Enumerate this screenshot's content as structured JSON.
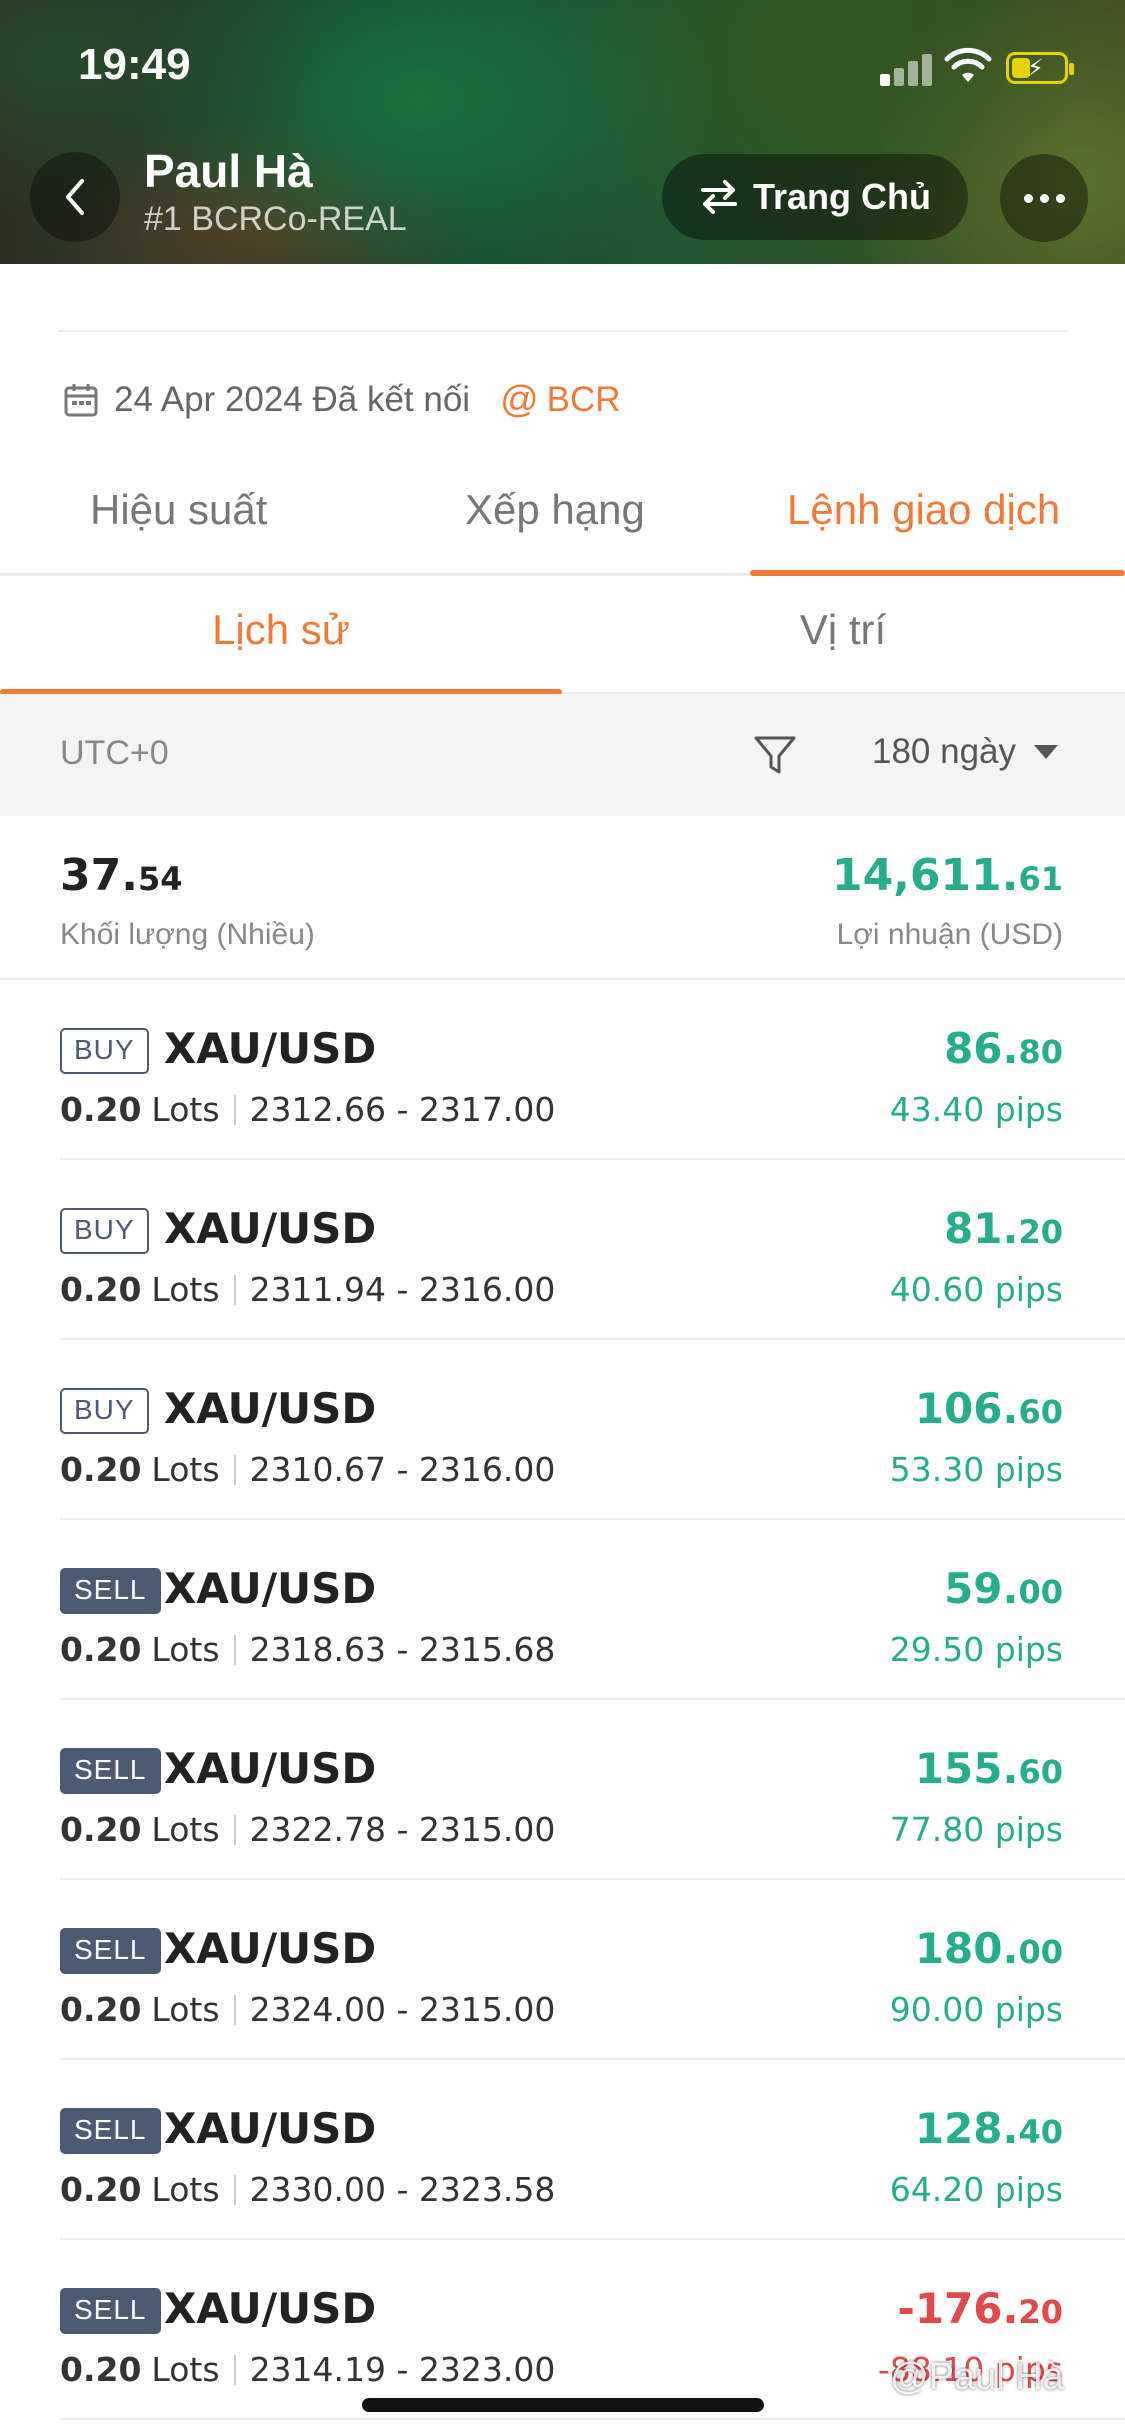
{
  "status_bar": {
    "time": "19:49"
  },
  "header": {
    "name": "Paul Hà",
    "account": "#1 BCRCo-REAL",
    "home_button": "Trang Chủ"
  },
  "connection": {
    "date_text": "24 Apr 2024 Đã kết nối",
    "broker_at": "@",
    "broker": "BCR"
  },
  "main_tabs": [
    {
      "label": "Hiệu suất"
    },
    {
      "label": "Xếp hạng"
    },
    {
      "label": "Lệnh giao dịch"
    }
  ],
  "sub_tabs": [
    {
      "label": "Lịch sử"
    },
    {
      "label": "Vị trí"
    }
  ],
  "filter": {
    "timezone": "UTC+0",
    "period": "180 ngày"
  },
  "summary": {
    "volume_int": "37.",
    "volume_dec": "54",
    "volume_label": "Khối lượng (Nhiều)",
    "profit_int": "14,611.",
    "profit_dec": "61",
    "profit_label": "Lợi nhuận (USD)"
  },
  "trades": [
    {
      "side": "BUY",
      "symbol": "XAU/USD",
      "lots": "0.20",
      "lots_unit": "Lots",
      "prices": "2312.66 - 2317.00",
      "profit_int": "86.",
      "profit_dec": "80",
      "pips": "43.40 pips"
    },
    {
      "side": "BUY",
      "symbol": "XAU/USD",
      "lots": "0.20",
      "lots_unit": "Lots",
      "prices": "2311.94 - 2316.00",
      "profit_int": "81.",
      "profit_dec": "20",
      "pips": "40.60 pips"
    },
    {
      "side": "BUY",
      "symbol": "XAU/USD",
      "lots": "0.20",
      "lots_unit": "Lots",
      "prices": "2310.67 - 2316.00",
      "profit_int": "106.",
      "profit_dec": "60",
      "pips": "53.30 pips"
    },
    {
      "side": "SELL",
      "symbol": "XAU/USD",
      "lots": "0.20",
      "lots_unit": "Lots",
      "prices": "2318.63 - 2315.68",
      "profit_int": "59.",
      "profit_dec": "00",
      "pips": "29.50 pips"
    },
    {
      "side": "SELL",
      "symbol": "XAU/USD",
      "lots": "0.20",
      "lots_unit": "Lots",
      "prices": "2322.78 - 2315.00",
      "profit_int": "155.",
      "profit_dec": "60",
      "pips": "77.80 pips"
    },
    {
      "side": "SELL",
      "symbol": "XAU/USD",
      "lots": "0.20",
      "lots_unit": "Lots",
      "prices": "2324.00 - 2315.00",
      "profit_int": "180.",
      "profit_dec": "00",
      "pips": "90.00 pips"
    },
    {
      "side": "SELL",
      "symbol": "XAU/USD",
      "lots": "0.20",
      "lots_unit": "Lots",
      "prices": "2330.00 - 2323.58",
      "profit_int": "128.",
      "profit_dec": "40",
      "pips": "64.20 pips"
    },
    {
      "side": "SELL",
      "symbol": "XAU/USD",
      "lots": "0.20",
      "lots_unit": "Lots",
      "prices": "2314.19 - 2323.00",
      "profit_int": "-176.",
      "profit_dec": "20",
      "pips": "-88.10 pips"
    }
  ],
  "watermark": "@Paul Hà",
  "colors": {
    "accent": "#f07a3a",
    "profit": "#27ad8d",
    "loss": "#e14a4a",
    "badge": "#4d5a73"
  }
}
